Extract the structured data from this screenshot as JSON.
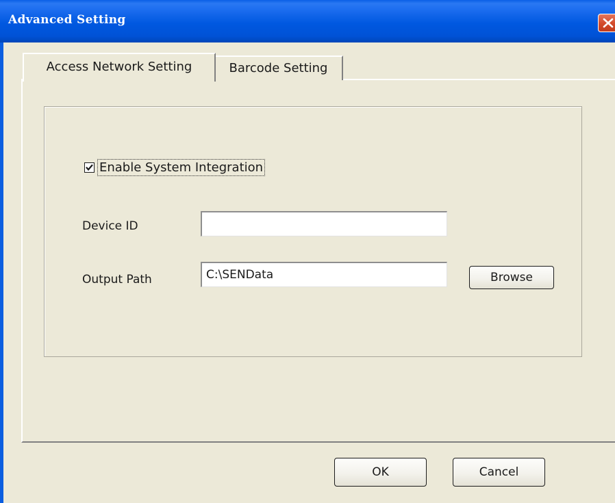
{
  "window": {
    "title": "Advanced Setting",
    "close_icon": "close-icon"
  },
  "tabs": [
    {
      "label": "Access Network Setting",
      "active": true
    },
    {
      "label": "Barcode Setting",
      "active": false
    }
  ],
  "form": {
    "enable_integration": {
      "label": "Enable System Integration",
      "checked": true
    },
    "device_id": {
      "label": "Device ID",
      "value": ""
    },
    "output_path": {
      "label": "Output Path",
      "value": "C:\\SENData"
    },
    "browse_label": "Browse"
  },
  "footer": {
    "ok_label": "OK",
    "cancel_label": "Cancel"
  },
  "colors": {
    "titlebar": "#0058e0",
    "face": "#ece9d8",
    "close": "#d24a2a"
  }
}
